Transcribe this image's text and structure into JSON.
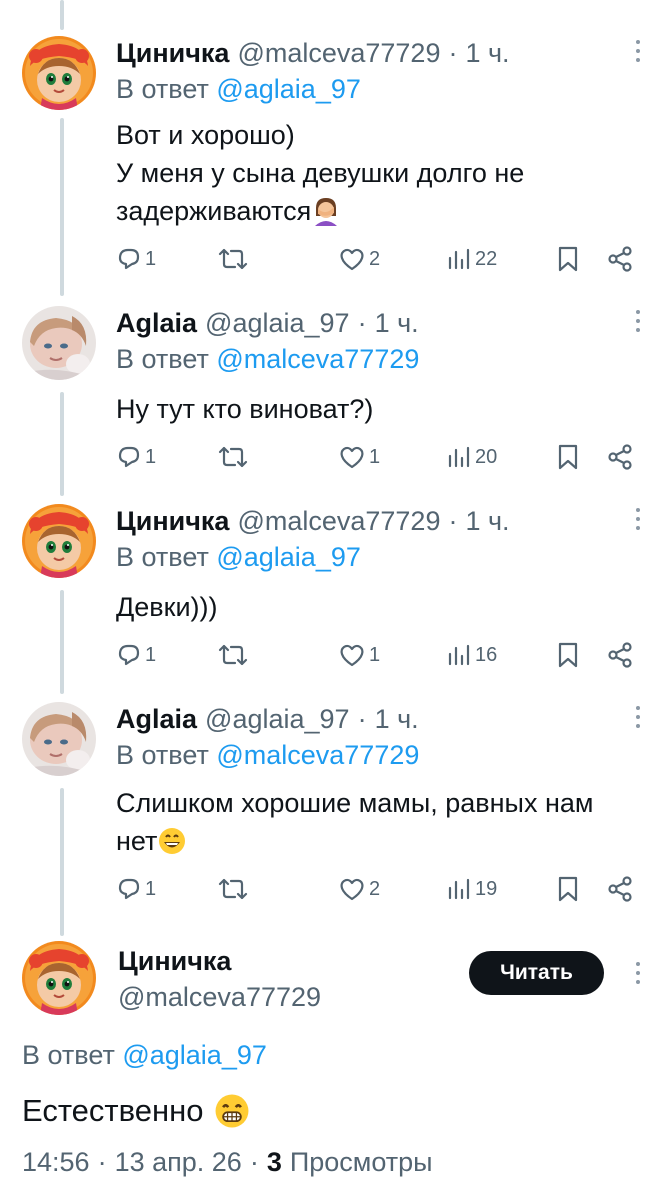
{
  "thread": [
    {
      "name": "Циничка",
      "handle": "@malceva77729",
      "dot": "·",
      "time": "1 ч.",
      "reply_prefix": "В ответ",
      "reply_to": "@aglaia_97",
      "lines": [
        "Вот и хорошо)",
        "У меня у сына девушки долго не",
        "задерживаются"
      ],
      "emoji": "facepalm",
      "counts": {
        "replies": "1",
        "retweets": "",
        "likes": "2",
        "views": "22"
      }
    },
    {
      "name": "Aglaia",
      "handle": "@aglaia_97",
      "dot": "·",
      "time": "1 ч.",
      "reply_prefix": "В ответ",
      "reply_to": "@malceva77729",
      "lines": [
        "Ну тут кто виноват?)"
      ],
      "counts": {
        "replies": "1",
        "retweets": "",
        "likes": "1",
        "views": "20"
      }
    },
    {
      "name": "Циничка",
      "handle": "@malceva77729",
      "dot": "·",
      "time": "1 ч.",
      "reply_prefix": "В ответ",
      "reply_to": "@aglaia_97",
      "lines": [
        "Девки)))"
      ],
      "counts": {
        "replies": "1",
        "retweets": "",
        "likes": "1",
        "views": "16"
      }
    },
    {
      "name": "Aglaia",
      "handle": "@aglaia_97",
      "dot": "·",
      "time": "1 ч.",
      "reply_prefix": "В ответ",
      "reply_to": "@malceva77729",
      "lines": [
        "Слишком хорошие мамы, равных нам",
        "нет"
      ],
      "emoji": "grinning",
      "counts": {
        "replies": "1",
        "retweets": "",
        "likes": "2",
        "views": "19"
      }
    }
  ],
  "main": {
    "name": "Циничка",
    "handle": "@malceva77729",
    "follow_label": "Читать",
    "reply_prefix": "В ответ",
    "reply_to": "@aglaia_97",
    "text": "Естественно",
    "emoji": "beaming",
    "time": "14:56",
    "sep1": "·",
    "date": "13 апр. 26",
    "sep2": "·",
    "views_count": "3",
    "views_label": "Просмотры"
  },
  "colors": {
    "link": "#1d9bf0",
    "muted": "#536471",
    "text": "#0f1419",
    "line": "#cfd9de"
  },
  "icons": [
    "reply-icon",
    "retweet-icon",
    "like-icon",
    "views-icon",
    "bookmark-icon",
    "share-icon",
    "more-icon"
  ]
}
